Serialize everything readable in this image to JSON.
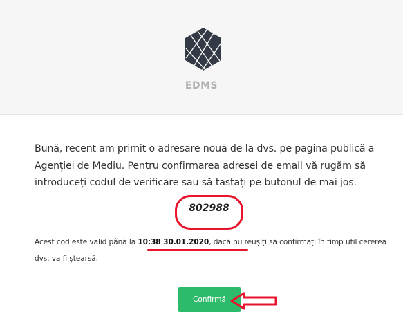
{
  "header": {
    "brand_name": "EDMS",
    "logo_icon": "hexagon-lines-logo",
    "background_color": "#f6f6f6"
  },
  "message": {
    "text": "Bună, recent am primit o adresare nouă de la dvs. pe pagina publică a Agenției de Mediu. Pentru confirmarea adresei de email vă rugăm să introduceți codul de verificare sau să tastați pe butonul de mai jos."
  },
  "verification": {
    "code": "802988",
    "highlight_color": "#e8142b"
  },
  "validity": {
    "prefix": "Acest cod este valid până la ",
    "timestamp": "10:38 30.01.2020",
    "suffix": ", dacă nu reușiți să confirmați în timp util cererea dvs. va fi ștearsă."
  },
  "actions": {
    "confirm_label": "Confirmă",
    "confirm_color": "#2dbb6b",
    "annotation_arrow_icon": "left-arrow-icon"
  }
}
